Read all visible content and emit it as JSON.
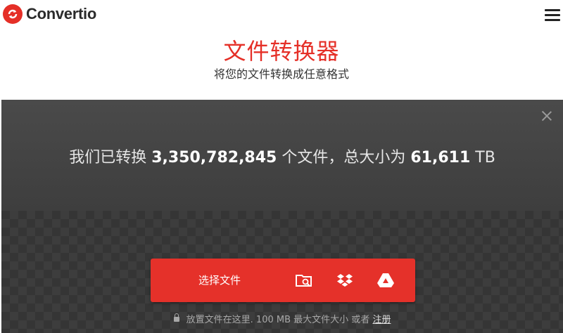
{
  "header": {
    "brand": "Convertio",
    "logo_icon": "convertio-logo-icon",
    "menu_icon": "hamburger-menu-icon"
  },
  "hero": {
    "title": "文件转换器",
    "subtitle": "将您的文件转换成任意格式"
  },
  "stats": {
    "prefix": "我们已转换",
    "files_count": "3,350,782,845",
    "middle": "个文件，总大小为",
    "total_size": "61,611",
    "unit": "TB",
    "close_icon": "close-icon"
  },
  "upload": {
    "choose_label": "选择文件",
    "sources": [
      "folder-search-icon",
      "dropbox-icon",
      "google-drive-icon"
    ],
    "note_text": "放置文件在这里. 100 MB 最大文件大小 或者",
    "register_link": "注册",
    "lock_icon": "lock-icon"
  },
  "colors": {
    "accent": "#e52f27",
    "dark_band": "#454545",
    "upload_bg": "#353535"
  }
}
